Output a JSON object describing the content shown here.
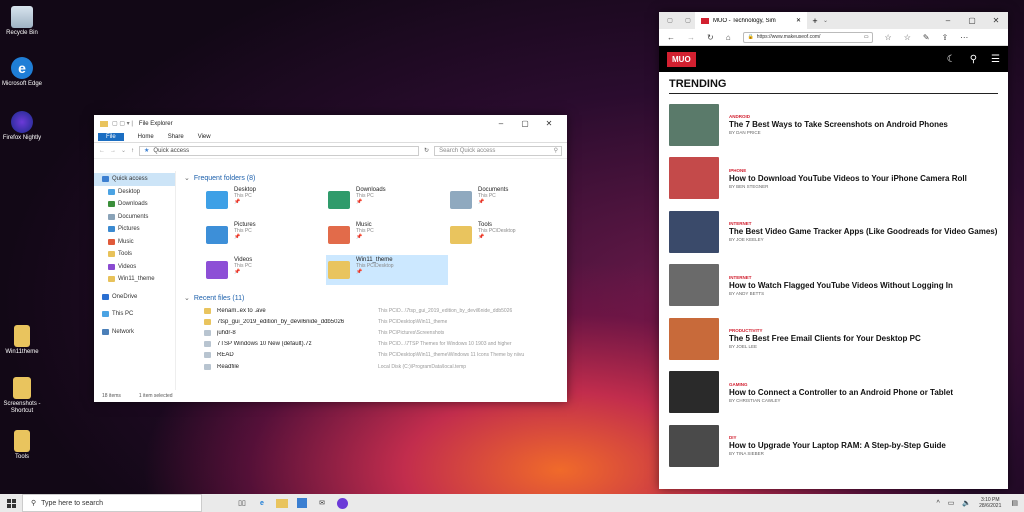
{
  "desktop": {
    "icons": [
      {
        "label": "Recycle Bin"
      },
      {
        "label": "Microsoft Edge"
      },
      {
        "label": "Firefox Nightly"
      },
      {
        "label": "Win11theme"
      },
      {
        "label": "Screenshots - Shortcut"
      },
      {
        "label": "Tools"
      }
    ]
  },
  "explorer": {
    "title": "File Explorer",
    "ribbon": [
      "File",
      "Home",
      "Share",
      "View"
    ],
    "address": "Quick access",
    "search_placeholder": "Search Quick access",
    "nav": [
      {
        "label": "Quick access",
        "color": "#3b7fd1",
        "selected": true
      },
      {
        "label": "Desktop",
        "color": "#4ba3e3"
      },
      {
        "label": "Downloads",
        "color": "#3b8f3b"
      },
      {
        "label": "Documents",
        "color": "#8aa3b8"
      },
      {
        "label": "Pictures",
        "color": "#3b8ad1"
      },
      {
        "label": "Music",
        "color": "#e05a3a"
      },
      {
        "label": "Tools",
        "color": "#e8c25a"
      },
      {
        "label": "Videos",
        "color": "#8a4bd1"
      },
      {
        "label": "Win11_theme",
        "color": "#e8c25a"
      },
      {
        "label": "OneDrive",
        "color": "#2a6fd1"
      },
      {
        "label": "This PC",
        "color": "#4ba3e3"
      },
      {
        "label": "Network",
        "color": "#4b7fb8"
      }
    ],
    "frequent_header": "Frequent folders (8)",
    "folders": [
      {
        "name": "Desktop",
        "sub": "This PC",
        "color": "#3ea0e6"
      },
      {
        "name": "Downloads",
        "sub": "This PC",
        "color": "#2f9b6b"
      },
      {
        "name": "Documents",
        "sub": "This PC",
        "color": "#8fa9bf"
      },
      {
        "name": "Pictures",
        "sub": "This PC",
        "color": "#3d8fd8"
      },
      {
        "name": "Music",
        "sub": "This PC",
        "color": "#e26b4a"
      },
      {
        "name": "Tools",
        "sub": "This PC\\Desktop",
        "color": "#e9c45e"
      },
      {
        "name": "Videos",
        "sub": "This PC",
        "color": "#8d4fd6"
      },
      {
        "name": "Win11_theme",
        "sub": "This PC\\Desktop",
        "color": "#e9c45e",
        "selected": true
      }
    ],
    "recent_header": "Recent files (11)",
    "recent": [
      {
        "name": "Renam..ex to .ave",
        "path": "This PC\\D...\\7tsp_gui_2019_edition_by_devil6nide_ddb5026"
      },
      {
        "name": "7tsp_gui_2019_edition_by_devil6nide_ddb5026",
        "path": "This PC\\Desktop\\Win11_theme"
      },
      {
        "name": "juhdr-8",
        "path": "This PC\\Pictures\\Screenshots"
      },
      {
        "name": "7TSP Windows 10 New (default).7z",
        "path": "This PC\\D...\\7TSP Themes for Windows 10 1903 and higher"
      },
      {
        "name": "READ",
        "path": "This PC\\Desktop\\Win11_theme\\Windows 11 Icons Theme by niivu"
      },
      {
        "name": "Readfile",
        "path": "Local Disk (C:)\\ProgramData\\local.temp"
      }
    ],
    "status_items": "18 items",
    "status_selected": "1 item selected"
  },
  "browser": {
    "tab_title": "MUO - Technology, Sim",
    "url": "https://www.makeuseof.com/",
    "logo": "MUO",
    "section": "TRENDING",
    "articles": [
      {
        "category": "Android",
        "title": "The 7 Best Ways to Take Screenshots on Android Phones",
        "byline": "By Dan Price",
        "color": "#5a7a6a"
      },
      {
        "category": "iPhone",
        "title": "How to Download YouTube Videos to Your iPhone Camera Roll",
        "byline": "By Ben Stegner",
        "color": "#c44a4a"
      },
      {
        "category": "Internet",
        "title": "The Best Video Game Tracker Apps (Like Goodreads for Video Games)",
        "byline": "By Joe Keeley",
        "color": "#3a4a6a"
      },
      {
        "category": "Internet",
        "title": "How to Watch Flagged YouTube Videos Without Logging In",
        "byline": "By Andy Betts",
        "color": "#6a6a6a"
      },
      {
        "category": "Productivity",
        "title": "The 5 Best Free Email Clients for Your Desktop PC",
        "byline": "By Joel Lee",
        "color": "#c86a3a"
      },
      {
        "category": "Gaming",
        "title": "How to Connect a Controller to an Android Phone or Tablet",
        "byline": "By Christian Cawley",
        "color": "#2a2a2a"
      },
      {
        "category": "DIY",
        "title": "How to Upgrade Your Laptop RAM: A Step-by-Step Guide",
        "byline": "By Tina Sieber",
        "color": "#4a4a4a"
      }
    ]
  },
  "taskbar": {
    "search_placeholder": "Type here to search",
    "time": "3:10 PM",
    "date": "28/6/2021"
  }
}
